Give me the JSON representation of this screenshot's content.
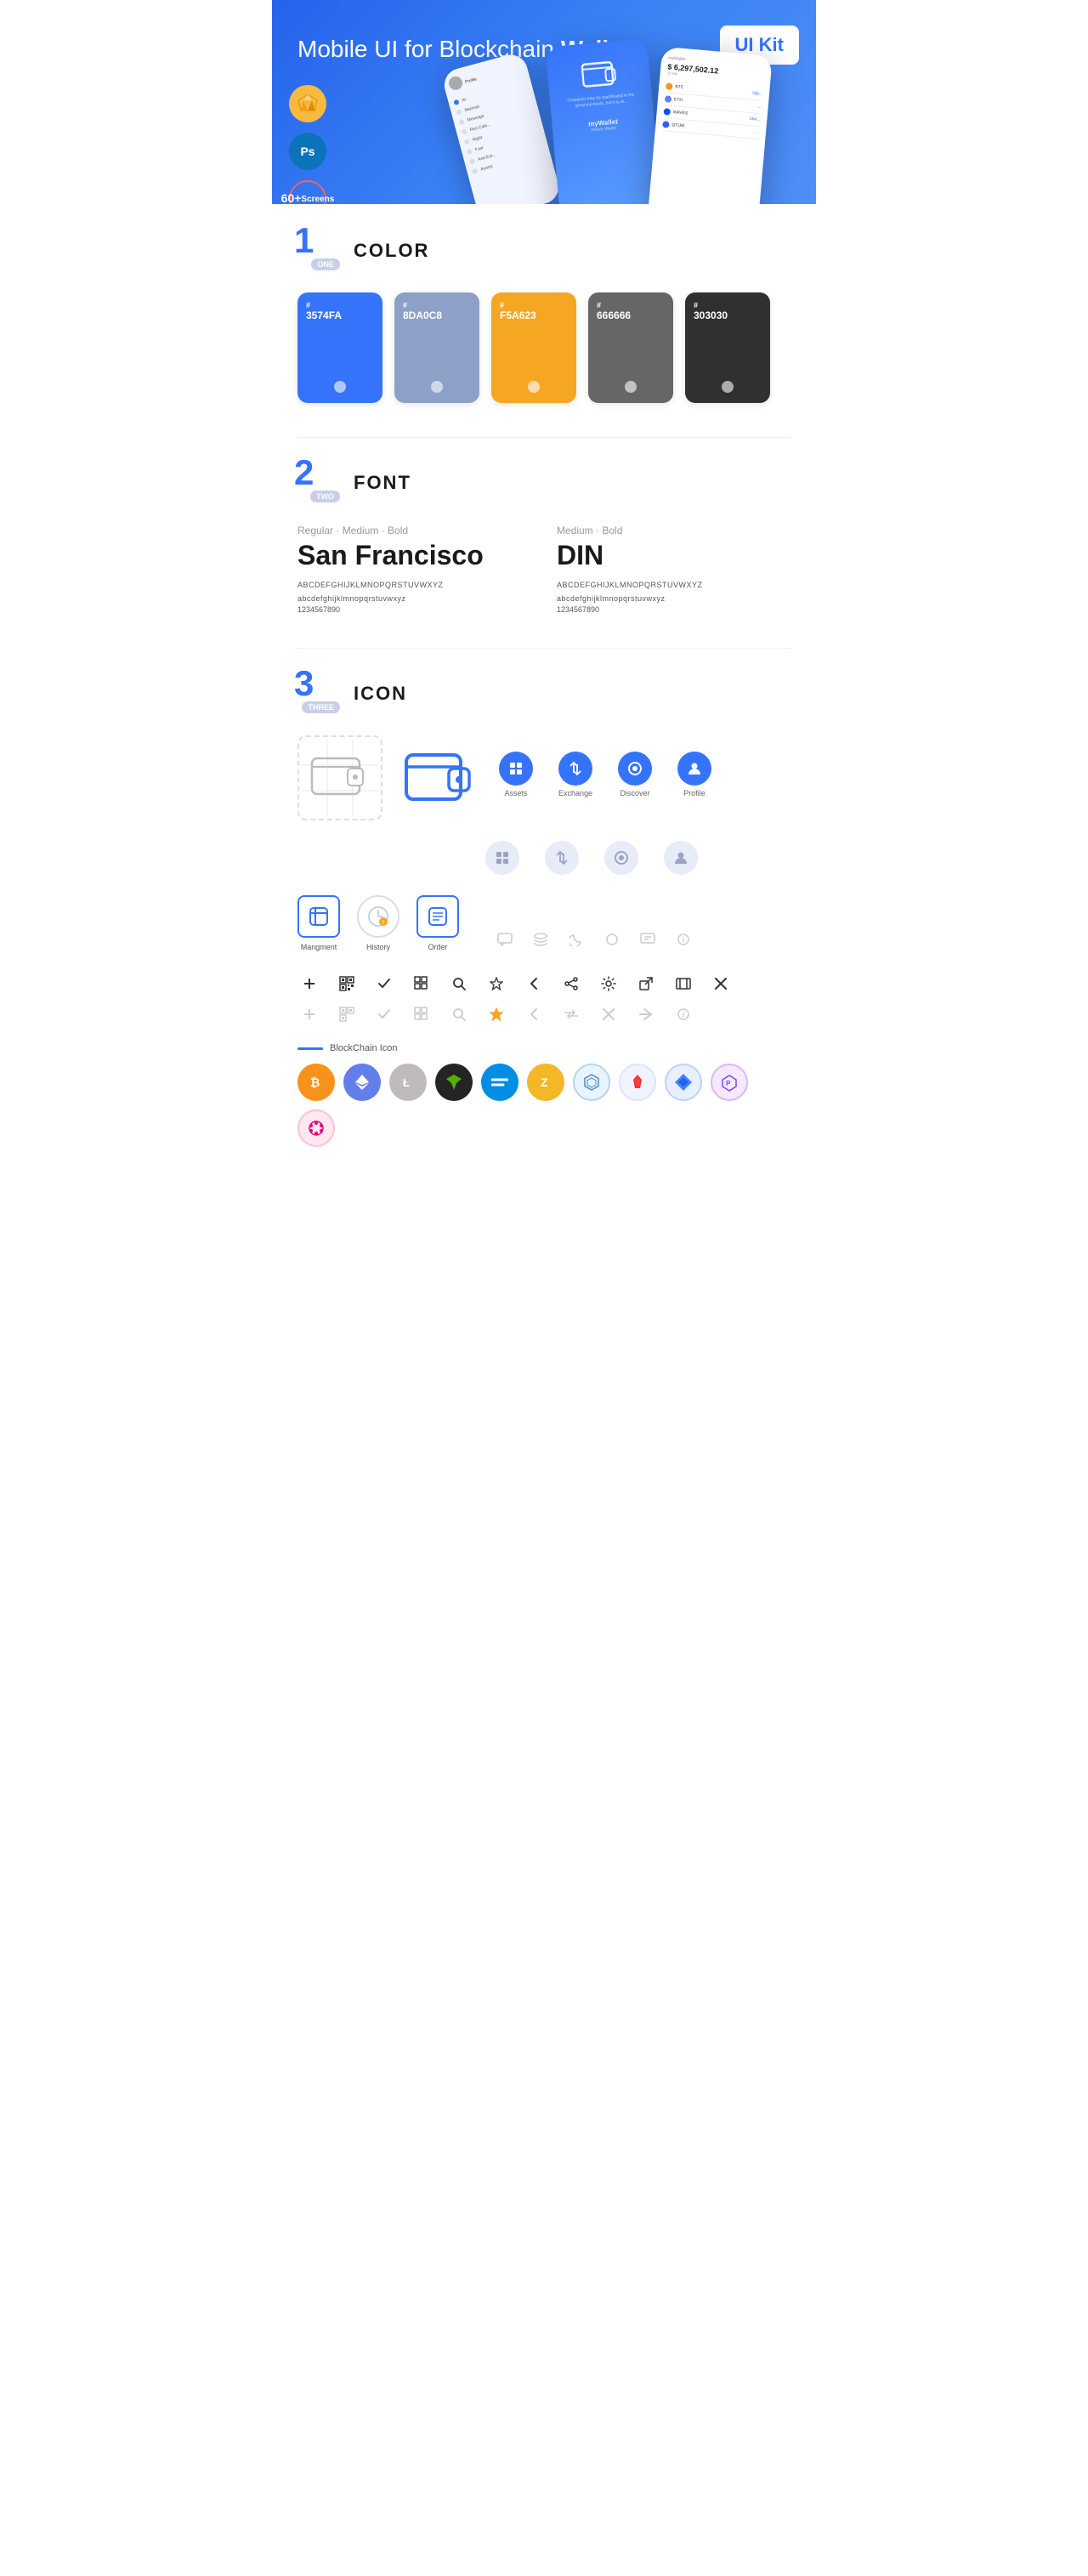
{
  "hero": {
    "title_regular": "Mobile UI for Blockchain ",
    "title_bold": "Wallet",
    "badge": "UI Kit",
    "tool_sketch": "S",
    "tool_ps": "Ps",
    "screens_count": "60+",
    "screens_label": "Screens"
  },
  "sections": {
    "color": {
      "number": "1",
      "word": "ONE",
      "title": "COLOR",
      "swatches": [
        {
          "hex": "#3574FA",
          "code": "3574FA",
          "hash": "#"
        },
        {
          "hex": "#8DA0C8",
          "code": "8DA0C8",
          "hash": "#"
        },
        {
          "hex": "#F5A623",
          "code": "F5A623",
          "hash": "#"
        },
        {
          "hex": "#666666",
          "code": "666666",
          "hash": "#"
        },
        {
          "hex": "#303030",
          "code": "303030",
          "hash": "#"
        }
      ]
    },
    "font": {
      "number": "2",
      "word": "TWO",
      "title": "FONT",
      "font1": {
        "style": "Regular · Medium · Bold",
        "name": "San Francisco",
        "upper": "ABCDEFGHIJKLMNOPQRSTUVWXYZ",
        "lower": "abcdefghijklmnopqrstuvwxyz",
        "numbers": "1234567890"
      },
      "font2": {
        "style": "Medium · Bold",
        "name": "DIN",
        "upper": "ABCDEFGHIJKLMNOPQRSTUVWXYZ",
        "lower": "abcdefghijklmnopqrstuvwxyz",
        "numbers": "1234567890"
      }
    },
    "icon": {
      "number": "3",
      "word": "THREE",
      "title": "ICON",
      "nav_icons": [
        {
          "label": "Assets"
        },
        {
          "label": "Exchange"
        },
        {
          "label": "Discover"
        },
        {
          "label": "Profile"
        }
      ],
      "app_icons": [
        {
          "label": "Mangment"
        },
        {
          "label": "History"
        },
        {
          "label": "Order"
        }
      ],
      "blockchain_label": "BlockChain Icon",
      "crypto": [
        "BTC",
        "ETH",
        "LTC",
        "NEO",
        "DASH",
        "ZEC",
        "IOTA",
        "ARK",
        "WAVES",
        "MATIC",
        "DOT"
      ]
    }
  }
}
